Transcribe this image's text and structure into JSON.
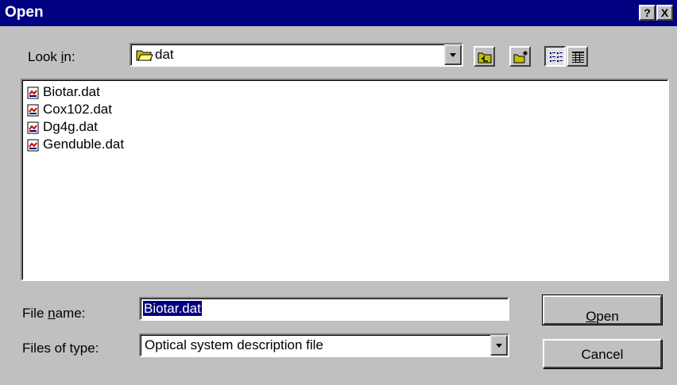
{
  "window": {
    "title": "Open",
    "help_label": "?",
    "close_label": "X"
  },
  "look_in": {
    "label_pre": "Look ",
    "label_key": "i",
    "label_post": "n:",
    "value": "dat"
  },
  "toolbar": {
    "buttons": [
      "up-one-level",
      "create-new-folder",
      "list-view",
      "details-view"
    ]
  },
  "files": [
    {
      "name": "Biotar.dat"
    },
    {
      "name": "Cox102.dat"
    },
    {
      "name": "Dg4g.dat"
    },
    {
      "name": "Genduble.dat"
    }
  ],
  "file_name": {
    "label_pre": "File ",
    "label_key": "n",
    "label_post": "ame:",
    "value": "Biotar.dat"
  },
  "file_type": {
    "label": "Files of type:",
    "value": "Optical system description file"
  },
  "buttons": {
    "open_key": "O",
    "open_rest": "pen",
    "cancel": "Cancel"
  },
  "colors": {
    "titlebar": "#000080",
    "face": "#c0c0c0",
    "selection": "#000080"
  }
}
